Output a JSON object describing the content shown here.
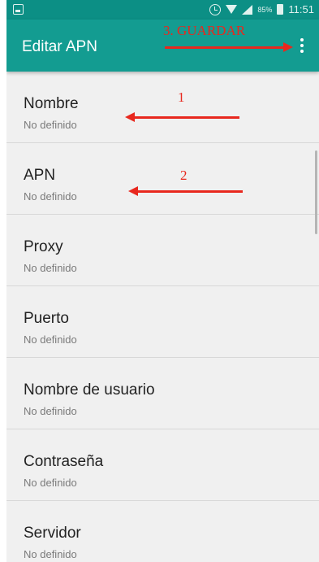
{
  "status_bar": {
    "battery_percent": "85%",
    "time": "11:51",
    "icons": [
      "screenshot-icon",
      "alarm-icon",
      "wifi-icon",
      "signal-icon",
      "battery-icon"
    ]
  },
  "toolbar": {
    "title": "Editar APN",
    "menu_icon": "more-vert-icon"
  },
  "annotations": {
    "save_text": "3. GUARDAR",
    "step1": "1",
    "step2": "2",
    "color": "#e8281e"
  },
  "items": [
    {
      "title": "Nombre",
      "value": "No definido"
    },
    {
      "title": "APN",
      "value": "No definido"
    },
    {
      "title": "Proxy",
      "value": "No definido"
    },
    {
      "title": "Puerto",
      "value": "No definido"
    },
    {
      "title": "Nombre de usuario",
      "value": "No definido"
    },
    {
      "title": "Contraseña",
      "value": "No definido"
    },
    {
      "title": "Servidor",
      "value": "No definido"
    }
  ],
  "colors": {
    "status_bar": "#0c8f85",
    "toolbar": "#139c91",
    "background": "#f0f0f0"
  }
}
